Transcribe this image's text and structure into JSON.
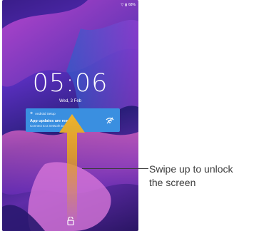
{
  "status_bar": {
    "battery": "68%"
  },
  "lockscreen": {
    "time": "05:06",
    "date": "Wed, 3 Feb"
  },
  "notification": {
    "app_name": "Android Setup",
    "title": "App updates are ready",
    "body": "Connect to a network to..."
  },
  "callout": {
    "line1": "Swipe up to unlock",
    "line2": "the screen"
  },
  "colors": {
    "notification_bg": "#3a8fe0",
    "arrow": "#e3a41d"
  }
}
